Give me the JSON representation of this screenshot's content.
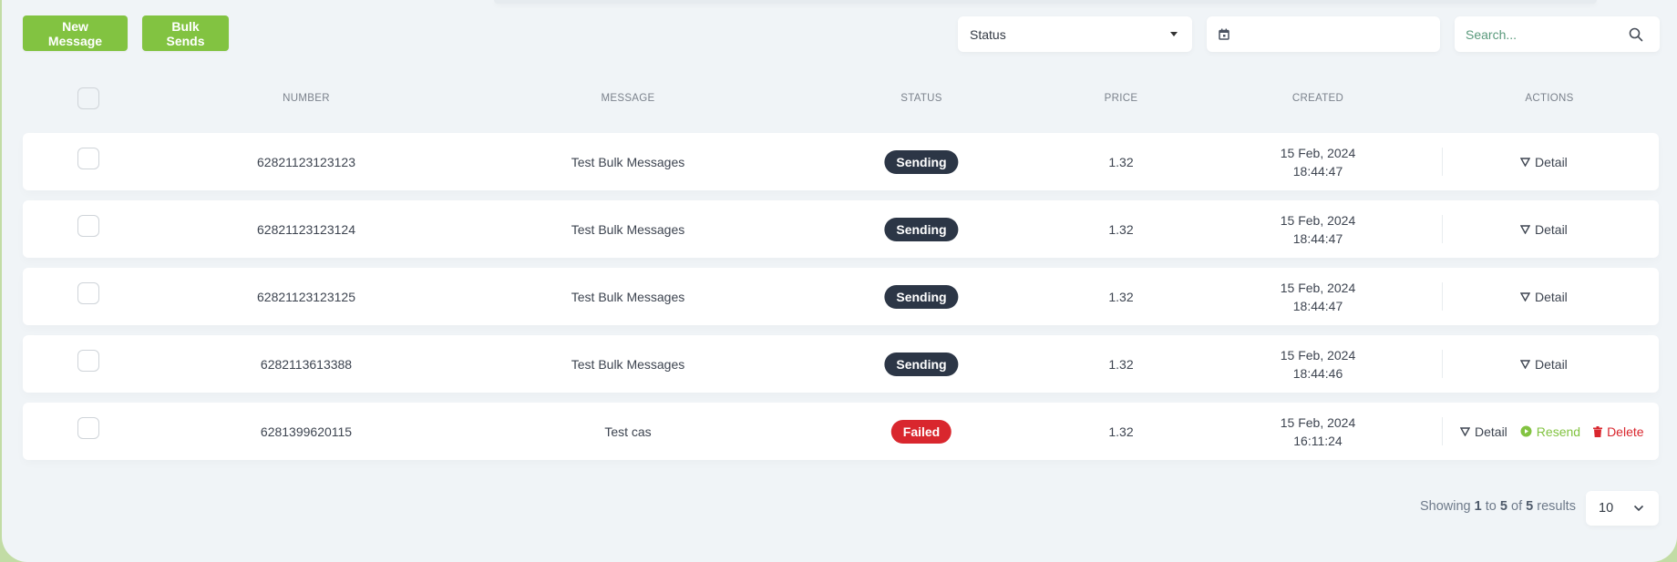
{
  "toolbar": {
    "new_message_label": "New Message",
    "bulk_sends_label": "Bulk Sends",
    "status_filter": {
      "selected": "Status"
    },
    "date_filter": {
      "value": ""
    },
    "search": {
      "placeholder": "Search...",
      "value": ""
    }
  },
  "table": {
    "columns": [
      "NUMBER",
      "MESSAGE",
      "STATUS",
      "PRICE",
      "CREATED",
      "ACTIONS"
    ],
    "rows": [
      {
        "number": "62821123123123",
        "message": "Test Bulk Messages",
        "status": "Sending",
        "price": "1.32",
        "created_date": "15 Feb, 2024",
        "created_time": "18:44:47",
        "actions": [
          "Detail"
        ]
      },
      {
        "number": "62821123123124",
        "message": "Test Bulk Messages",
        "status": "Sending",
        "price": "1.32",
        "created_date": "15 Feb, 2024",
        "created_time": "18:44:47",
        "actions": [
          "Detail"
        ]
      },
      {
        "number": "62821123123125",
        "message": "Test Bulk Messages",
        "status": "Sending",
        "price": "1.32",
        "created_date": "15 Feb, 2024",
        "created_time": "18:44:47",
        "actions": [
          "Detail"
        ]
      },
      {
        "number": "6282113613388",
        "message": "Test Bulk Messages",
        "status": "Sending",
        "price": "1.32",
        "created_date": "15 Feb, 2024",
        "created_time": "18:44:46",
        "actions": [
          "Detail"
        ]
      },
      {
        "number": "6281399620115",
        "message": "Test cas",
        "status": "Failed",
        "price": "1.32",
        "created_date": "15 Feb, 2024",
        "created_time": "16:11:24",
        "actions": [
          "Detail",
          "Resend",
          "Delete"
        ]
      }
    ]
  },
  "footer": {
    "showing_prefix": "Showing",
    "from": "1",
    "to_word": "to",
    "to": "5",
    "of_word": "of",
    "total": "5",
    "suffix": "results",
    "per_page": "10"
  },
  "colors": {
    "accent_green": "#82c341",
    "sending_badge": "#2c3646",
    "failed_badge": "#d9272e",
    "page_bg": "#f0f4f7"
  }
}
